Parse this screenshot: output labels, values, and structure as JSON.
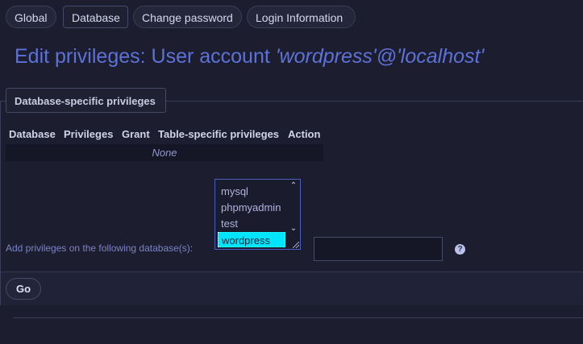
{
  "tabs": [
    {
      "label": "Global"
    },
    {
      "label": "Database"
    },
    {
      "label": "Change password"
    },
    {
      "label": "Login Information"
    }
  ],
  "page": {
    "title_prefix": "Edit privileges: User account ",
    "title_user": "'wordpress'@'localhost'"
  },
  "section": {
    "legend": "Database-specific privileges"
  },
  "table": {
    "columns": [
      "Database",
      "Privileges",
      "Grant",
      "Table-specific privileges",
      "Action"
    ],
    "empty_text": "None"
  },
  "add_form": {
    "label": "Add privileges on the following database(s):",
    "options": [
      "mysql",
      "phpmyadmin",
      "test",
      "wordpress"
    ],
    "selected": "wordpress",
    "input_value": ""
  },
  "actions": {
    "go_label": "Go"
  },
  "colors": {
    "accent": "#5d72d8",
    "selection": "#00e5ff",
    "background": "#1c1d2e"
  },
  "icons": {
    "help": "help-icon",
    "scroll_up": "chevron-up-icon",
    "scroll_down": "chevron-down-icon"
  }
}
